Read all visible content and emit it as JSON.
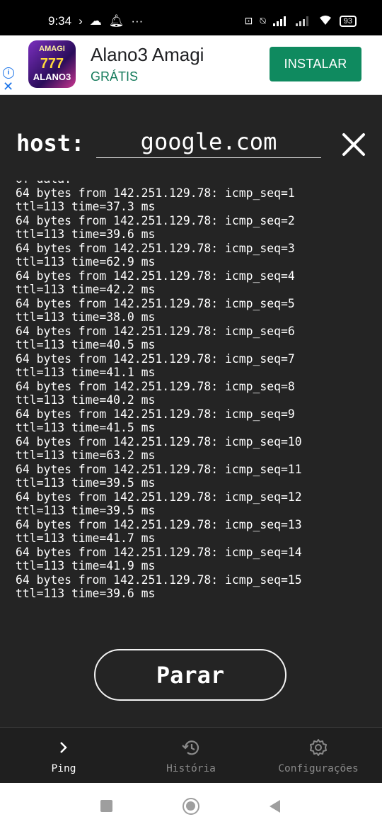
{
  "status_bar": {
    "time": "9:34",
    "battery": "93"
  },
  "ad": {
    "app_name": "Alano3 Amagi",
    "price_label": "GRÁTIS",
    "install_label": "INSTALAR",
    "icon_text_top": "AMAGI",
    "icon_text_mid": "777",
    "icon_text_bottom": "ALANO3"
  },
  "host": {
    "label": "host:",
    "value": "google.com"
  },
  "output": {
    "lines": [
      "of data.",
      "64 bytes from 142.251.129.78: icmp_seq=1",
      "ttl=113 time=37.3 ms",
      "64 bytes from 142.251.129.78: icmp_seq=2",
      "ttl=113 time=39.6 ms",
      "64 bytes from 142.251.129.78: icmp_seq=3",
      "ttl=113 time=62.9 ms",
      "64 bytes from 142.251.129.78: icmp_seq=4",
      "ttl=113 time=42.2 ms",
      "64 bytes from 142.251.129.78: icmp_seq=5",
      "ttl=113 time=38.0 ms",
      "64 bytes from 142.251.129.78: icmp_seq=6",
      "ttl=113 time=40.5 ms",
      "64 bytes from 142.251.129.78: icmp_seq=7",
      "ttl=113 time=41.1 ms",
      "64 bytes from 142.251.129.78: icmp_seq=8",
      "ttl=113 time=40.2 ms",
      "64 bytes from 142.251.129.78: icmp_seq=9",
      "ttl=113 time=41.5 ms",
      "64 bytes from 142.251.129.78: icmp_seq=10",
      "ttl=113 time=63.2 ms",
      "64 bytes from 142.251.129.78: icmp_seq=11",
      "ttl=113 time=39.5 ms",
      "64 bytes from 142.251.129.78: icmp_seq=12",
      "ttl=113 time=39.5 ms",
      "64 bytes from 142.251.129.78: icmp_seq=13",
      "ttl=113 time=41.7 ms",
      "64 bytes from 142.251.129.78: icmp_seq=14",
      "ttl=113 time=41.9 ms",
      "64 bytes from 142.251.129.78: icmp_seq=15",
      "ttl=113 time=39.6 ms"
    ]
  },
  "stop_button": {
    "label": "Parar"
  },
  "bottom_nav": {
    "items": [
      {
        "label": "Ping",
        "icon": "chevron-right-icon",
        "active": true
      },
      {
        "label": "História",
        "icon": "history-icon",
        "active": false
      },
      {
        "label": "Configurações",
        "icon": "gear-icon",
        "active": false
      }
    ]
  },
  "colors": {
    "background": "#242424",
    "ad_button": "#0f8a5f",
    "nav_active": "#ffffff",
    "nav_inactive": "#8a8a8a"
  }
}
